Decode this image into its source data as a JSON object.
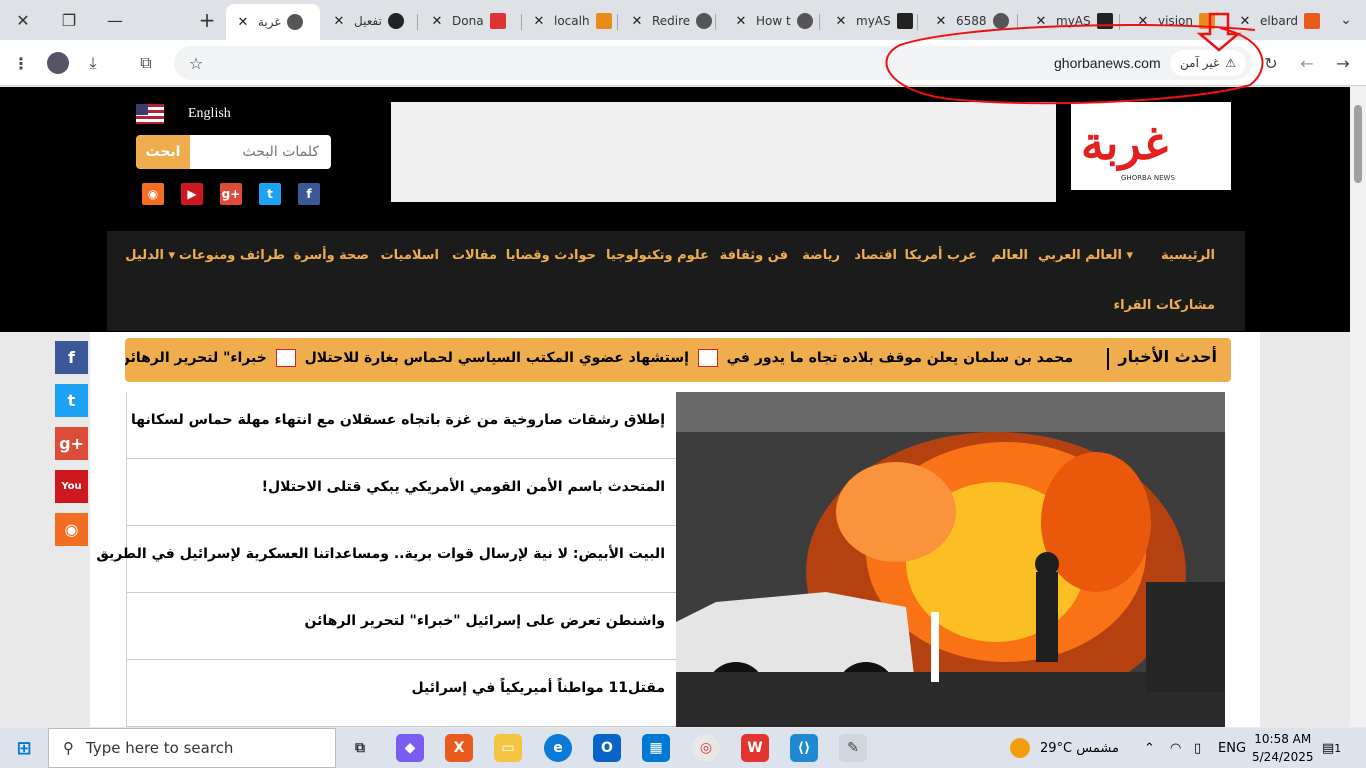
{
  "browser": {
    "tabs": [
      {
        "title": "غربة",
        "active": true
      },
      {
        "title": "تفعيل",
        "active": false
      },
      {
        "title": "Dona",
        "active": false
      },
      {
        "title": "localh",
        "active": false
      },
      {
        "title": "Redire",
        "active": false
      },
      {
        "title": "How t",
        "active": false
      },
      {
        "title": "myAS",
        "active": false
      },
      {
        "title": "6588",
        "active": false
      },
      {
        "title": "myAS",
        "active": false
      },
      {
        "title": "vision",
        "active": false
      },
      {
        "title": "elbard",
        "active": false
      }
    ],
    "url": "ghorbanews.com",
    "security_label": "غير آمن"
  },
  "site": {
    "logo_text": "غربة",
    "logo_sub": "GHORBA NEWS",
    "language": "English",
    "search_button": "ابحث",
    "search_placeholder": "كلمات البحث",
    "nav": [
      {
        "label": "الرئيسية"
      },
      {
        "label": "العالم العربي"
      },
      {
        "label": "العالم"
      },
      {
        "label": "عرب أمريكا"
      },
      {
        "label": "اقتصاد"
      },
      {
        "label": "رياضة"
      },
      {
        "label": "فن وثقافة"
      },
      {
        "label": "علوم وتكنولوجيا"
      },
      {
        "label": "حوادث وقضايا"
      },
      {
        "label": "مقالات"
      },
      {
        "label": "اسلاميات"
      },
      {
        "label": "صحة وأسرة"
      },
      {
        "label": "طرائف ومنوعات"
      },
      {
        "label": "الدليل"
      },
      {
        "label": "مشاركات القراء"
      }
    ],
    "ticker_label": "أحدث الأخبار",
    "ticker_items": [
      "محمد بن سلمان يعلن موقف بلاده تجاه ما يدور في",
      "إستشهاد عضوي المكتب السياسي لحماس بغارة للاحتلال",
      "خبراء\" لتحرير الرهائن"
    ],
    "news": [
      "إطلاق رشقات صاروخية من غزة باتجاه عسقلان مع انتهاء مهلة حماس لسكانها",
      "المتحدث باسم الأمن القومي الأمريكي يبكي قتلى الاحتلال!",
      "البيت الأبيض: لا نية لإرسال قوات برية.. ومساعداتنا العسكرية لإسرائيل في الطريق",
      "واشنطن تعرض على إسرائيل \"خبراء\" لتحرير الرهائن",
      "مقتل11 مواطناً أميريكياً في إسرائيل"
    ]
  },
  "taskbar": {
    "search_placeholder": "Type here to search",
    "weather": "29°C",
    "weather_text": "مشمس",
    "language": "ENG",
    "time": "10:58 AM",
    "date": "5/24/2025",
    "notifications": "1",
    "weather_badge": "1"
  }
}
